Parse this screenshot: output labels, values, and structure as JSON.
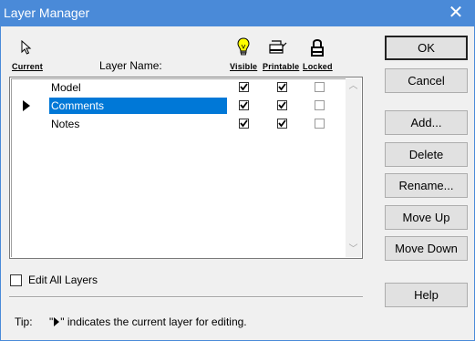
{
  "window": {
    "title": "Layer Manager",
    "close_glyph": "✕"
  },
  "headers": {
    "current": "Current",
    "layer_name": "Layer Name:",
    "visible": "Visible",
    "printable": "Printable",
    "locked": "Locked",
    "current_icon": "cursor-arrow-icon",
    "visible_icon": "light-bulb-icon",
    "printable_icon": "printer-icon",
    "locked_icon": "padlock-icon"
  },
  "layers": [
    {
      "name": "Model",
      "current": false,
      "selected": false,
      "visible": true,
      "printable": true,
      "locked": false
    },
    {
      "name": "Comments",
      "current": true,
      "selected": true,
      "visible": true,
      "printable": true,
      "locked": false
    },
    {
      "name": "Notes",
      "current": false,
      "selected": false,
      "visible": true,
      "printable": true,
      "locked": false
    }
  ],
  "edit_all": {
    "label": "Edit All Layers",
    "checked": false
  },
  "buttons": {
    "ok": "OK",
    "cancel": "Cancel",
    "add": "Add...",
    "delete": "Delete",
    "rename": "Rename...",
    "move_up": "Move Up",
    "move_down": "Move Down",
    "help": "Help"
  },
  "tip": {
    "label": "Tip:",
    "text_before": "\"",
    "text_after": "\" indicates the current layer for editing."
  },
  "colors": {
    "titlebar": "#4a8ad8",
    "selection": "#0078d7"
  }
}
